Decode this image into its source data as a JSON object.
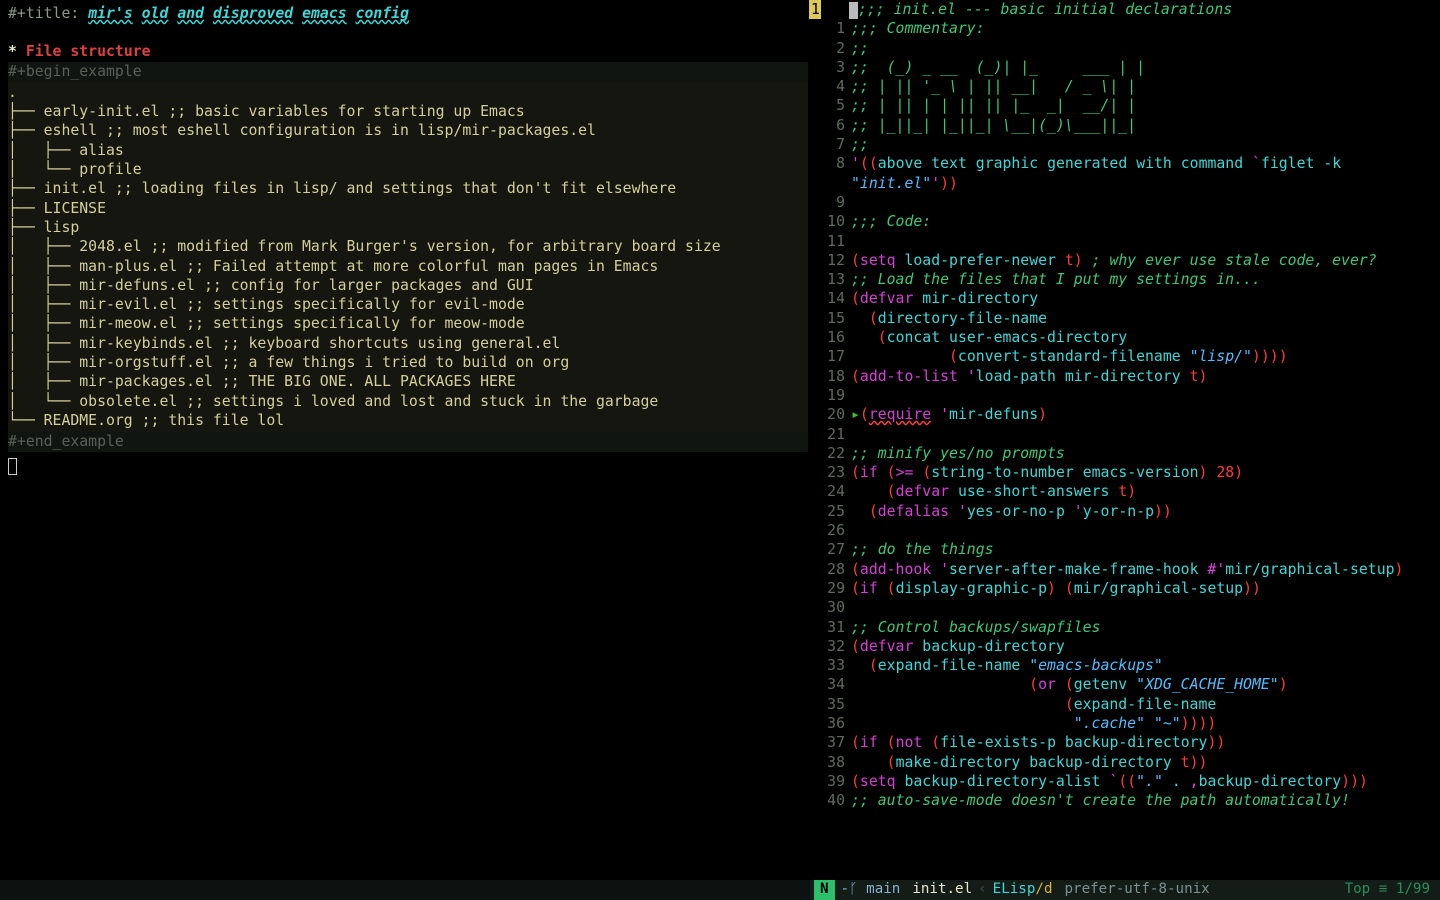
{
  "left": {
    "title_key": "#+title: ",
    "title_words": [
      "mir's",
      "old",
      "and",
      "disproved",
      "emacs",
      "config"
    ],
    "section_heading": "File structure",
    "begin_example": "#+begin_example",
    "end_example": "#+end_example",
    "tree_lines": [
      ".",
      "├── early-init.el ;; basic variables for starting up Emacs",
      "├── eshell ;; most eshell configuration is in lisp/mir-packages.el",
      "│   ├── alias",
      "│   └── profile",
      "├── init.el ;; loading files in lisp/ and settings that don't fit elsewhere",
      "├── LICENSE",
      "├── lisp",
      "│   ├── 2048.el ;; modified from Mark Burger's version, for arbitrary board size",
      "│   ├── man-plus.el ;; Failed attempt at more colorful man pages in Emacs",
      "│   ├── mir-defuns.el ;; config for larger packages and GUI",
      "│   ├── mir-evil.el ;; settings specifically for evil-mode",
      "│   ├── mir-meow.el ;; settings specifically for meow-mode",
      "│   ├── mir-keybinds.el ;; keyboard shortcuts using general.el",
      "│   ├── mir-orgstuff.el ;; a few things i tried to build on org",
      "│   ├── mir-packages.el ;; THE BIG ONE. ALL PACKAGES HERE",
      "│   └── obsolete.el ;; settings i loved and lost and stuck in the garbage",
      "└── README.org ;; this file lol"
    ]
  },
  "right": {
    "highlight_line": "1",
    "lines": [
      ";;; init.el --- basic initial declarations",
      ";;; Commentary:",
      ";;",
      ";;  (_) _ __  (_)| |_     ___ | |",
      ";; | || '_ \\ | || __|   / _ \\| |",
      ";; | || | | || || |_  _|  __/| |",
      ";; |_||_| |_||_| \\__|(_)\\___||_|",
      ";;",
      "'((above text graphic generated with command `figlet -k \"init.el\"'))",
      "",
      ";;; Code:",
      "",
      "(setq load-prefer-newer t) ; why ever use stale code, ever?",
      ";; Load the files that I put my settings in...",
      "(defvar mir-directory",
      "  (directory-file-name",
      "   (concat user-emacs-directory",
      "           (convert-standard-filename \"lisp/\"))))",
      "(add-to-list 'load-path mir-directory t)",
      "",
      "(require 'mir-defuns)",
      "",
      ";; minify yes/no prompts",
      "(if (>= (string-to-number emacs-version) 28)",
      "    (defvar use-short-answers t)",
      "  (defalias 'yes-or-no-p 'y-or-n-p))",
      "",
      ";; do the things",
      "(add-hook 'server-after-make-frame-hook #'mir/graphical-setup)",
      "(if (display-graphic-p) (mir/graphical-setup))",
      "",
      ";; Control backups/swapfiles",
      "(defvar backup-directory",
      "  (expand-file-name \"emacs-backups\"",
      "                    (or (getenv \"XDG_CACHE_HOME\")",
      "                        (expand-file-name",
      "                         \".cache\" \"~\"))))",
      "(if (not (file-exists-p backup-directory))",
      "    (make-directory backup-directory t))",
      "(setq backup-directory-alist `((\".\" . ,backup-directory)))",
      ";; auto-save-mode doesn't create the path automatically!"
    ]
  },
  "modeline": {
    "state": "N",
    "branch_icon": "-ᚴ",
    "branch": "main",
    "file": "init.el",
    "sep": "‹",
    "mode": "ELisp",
    "slash": "/",
    "mode_suffix": "d",
    "encoding": "prefer-utf-8-unix",
    "pos": "Top ≡ 1/99"
  }
}
